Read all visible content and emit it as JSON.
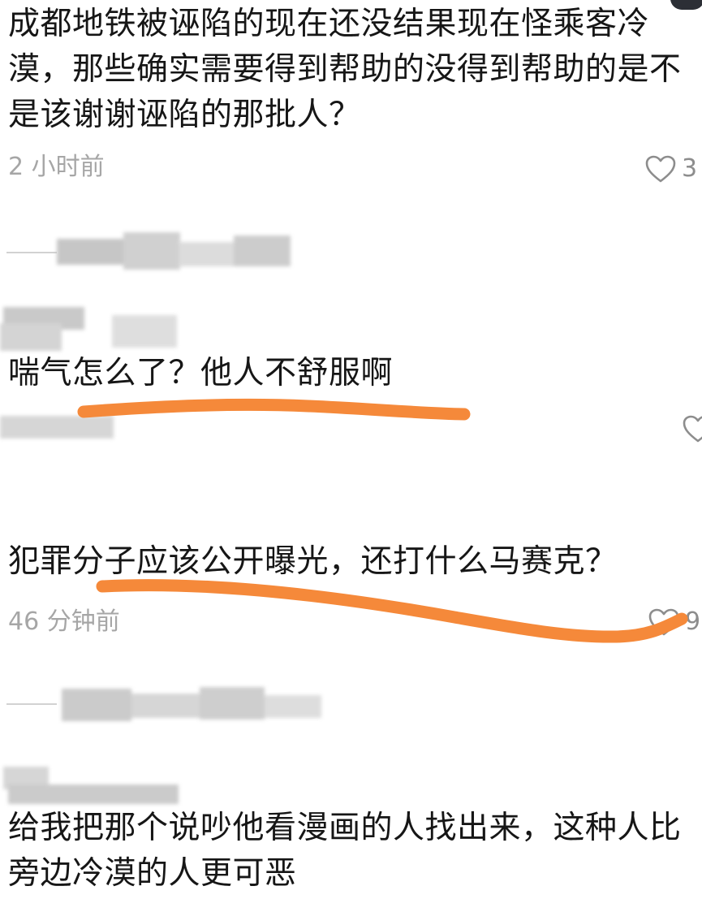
{
  "comments": [
    {
      "text": "成都地铁被诬陷的现在还没结果现在怪乘客冷漠，那些确实需要得到帮助的没得到帮助的是不是该谢谢诬陷的那批人？",
      "time": "2 小时前",
      "likes": "3"
    },
    {
      "text": "喘气怎么了？他人不舒服啊"
    },
    {
      "text": "犯罪分子应该公开曝光，还打什么马赛克？",
      "time": "46 分钟前",
      "likes": "9"
    },
    {
      "text": "给我把那个说吵他看漫画的人找出来，这种人比旁边冷漠的人更可恶"
    }
  ],
  "colors": {
    "text": "#161616",
    "meta": "#a6a6a6",
    "annotation_underline": "#f5893a"
  },
  "icons": {
    "like": "heart-outline-icon"
  }
}
